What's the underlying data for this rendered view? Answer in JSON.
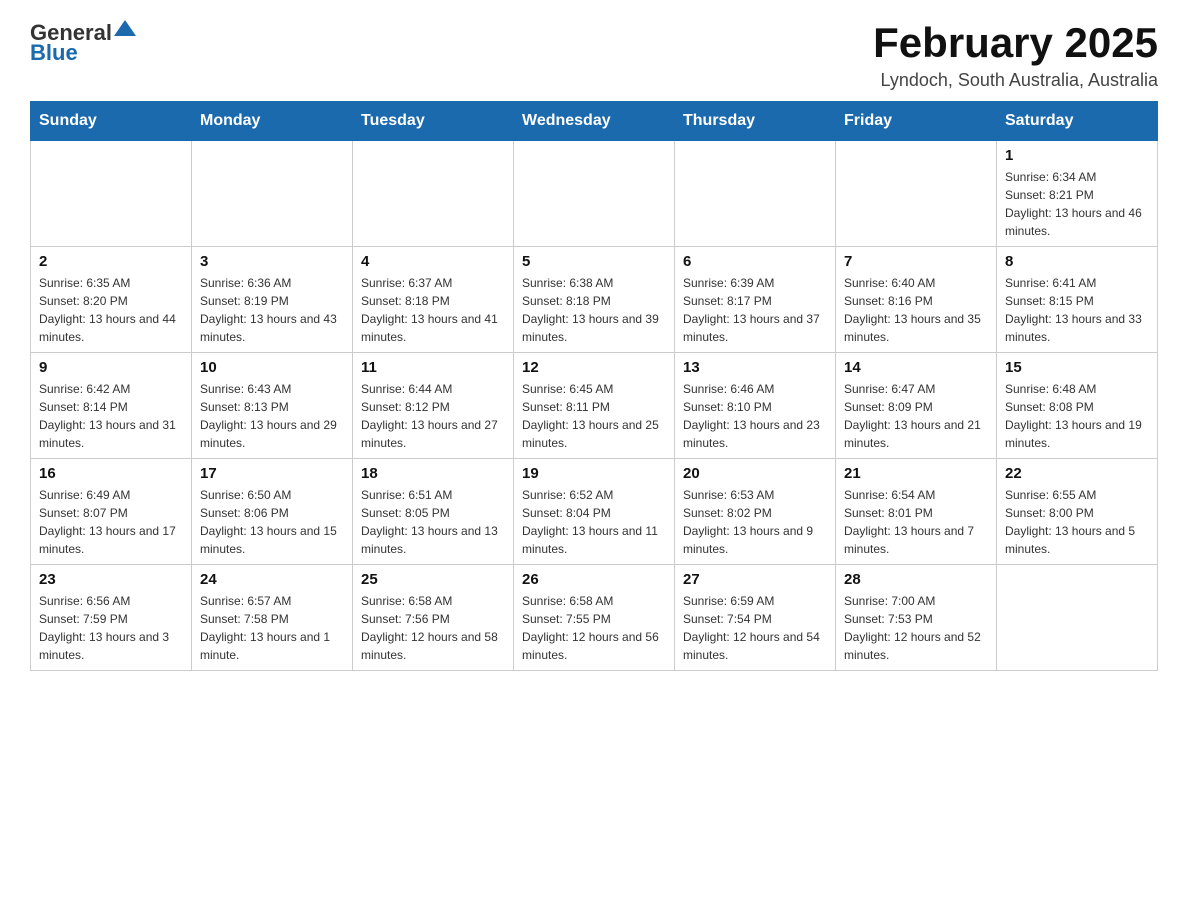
{
  "header": {
    "logo_general": "General",
    "logo_blue": "Blue",
    "title": "February 2025",
    "location": "Lyndoch, South Australia, Australia"
  },
  "days_of_week": [
    "Sunday",
    "Monday",
    "Tuesday",
    "Wednesday",
    "Thursday",
    "Friday",
    "Saturday"
  ],
  "weeks": [
    {
      "days": [
        {
          "num": "",
          "info": ""
        },
        {
          "num": "",
          "info": ""
        },
        {
          "num": "",
          "info": ""
        },
        {
          "num": "",
          "info": ""
        },
        {
          "num": "",
          "info": ""
        },
        {
          "num": "",
          "info": ""
        },
        {
          "num": "1",
          "info": "Sunrise: 6:34 AM\nSunset: 8:21 PM\nDaylight: 13 hours and 46 minutes."
        }
      ]
    },
    {
      "days": [
        {
          "num": "2",
          "info": "Sunrise: 6:35 AM\nSunset: 8:20 PM\nDaylight: 13 hours and 44 minutes."
        },
        {
          "num": "3",
          "info": "Sunrise: 6:36 AM\nSunset: 8:19 PM\nDaylight: 13 hours and 43 minutes."
        },
        {
          "num": "4",
          "info": "Sunrise: 6:37 AM\nSunset: 8:18 PM\nDaylight: 13 hours and 41 minutes."
        },
        {
          "num": "5",
          "info": "Sunrise: 6:38 AM\nSunset: 8:18 PM\nDaylight: 13 hours and 39 minutes."
        },
        {
          "num": "6",
          "info": "Sunrise: 6:39 AM\nSunset: 8:17 PM\nDaylight: 13 hours and 37 minutes."
        },
        {
          "num": "7",
          "info": "Sunrise: 6:40 AM\nSunset: 8:16 PM\nDaylight: 13 hours and 35 minutes."
        },
        {
          "num": "8",
          "info": "Sunrise: 6:41 AM\nSunset: 8:15 PM\nDaylight: 13 hours and 33 minutes."
        }
      ]
    },
    {
      "days": [
        {
          "num": "9",
          "info": "Sunrise: 6:42 AM\nSunset: 8:14 PM\nDaylight: 13 hours and 31 minutes."
        },
        {
          "num": "10",
          "info": "Sunrise: 6:43 AM\nSunset: 8:13 PM\nDaylight: 13 hours and 29 minutes."
        },
        {
          "num": "11",
          "info": "Sunrise: 6:44 AM\nSunset: 8:12 PM\nDaylight: 13 hours and 27 minutes."
        },
        {
          "num": "12",
          "info": "Sunrise: 6:45 AM\nSunset: 8:11 PM\nDaylight: 13 hours and 25 minutes."
        },
        {
          "num": "13",
          "info": "Sunrise: 6:46 AM\nSunset: 8:10 PM\nDaylight: 13 hours and 23 minutes."
        },
        {
          "num": "14",
          "info": "Sunrise: 6:47 AM\nSunset: 8:09 PM\nDaylight: 13 hours and 21 minutes."
        },
        {
          "num": "15",
          "info": "Sunrise: 6:48 AM\nSunset: 8:08 PM\nDaylight: 13 hours and 19 minutes."
        }
      ]
    },
    {
      "days": [
        {
          "num": "16",
          "info": "Sunrise: 6:49 AM\nSunset: 8:07 PM\nDaylight: 13 hours and 17 minutes."
        },
        {
          "num": "17",
          "info": "Sunrise: 6:50 AM\nSunset: 8:06 PM\nDaylight: 13 hours and 15 minutes."
        },
        {
          "num": "18",
          "info": "Sunrise: 6:51 AM\nSunset: 8:05 PM\nDaylight: 13 hours and 13 minutes."
        },
        {
          "num": "19",
          "info": "Sunrise: 6:52 AM\nSunset: 8:04 PM\nDaylight: 13 hours and 11 minutes."
        },
        {
          "num": "20",
          "info": "Sunrise: 6:53 AM\nSunset: 8:02 PM\nDaylight: 13 hours and 9 minutes."
        },
        {
          "num": "21",
          "info": "Sunrise: 6:54 AM\nSunset: 8:01 PM\nDaylight: 13 hours and 7 minutes."
        },
        {
          "num": "22",
          "info": "Sunrise: 6:55 AM\nSunset: 8:00 PM\nDaylight: 13 hours and 5 minutes."
        }
      ]
    },
    {
      "days": [
        {
          "num": "23",
          "info": "Sunrise: 6:56 AM\nSunset: 7:59 PM\nDaylight: 13 hours and 3 minutes."
        },
        {
          "num": "24",
          "info": "Sunrise: 6:57 AM\nSunset: 7:58 PM\nDaylight: 13 hours and 1 minute."
        },
        {
          "num": "25",
          "info": "Sunrise: 6:58 AM\nSunset: 7:56 PM\nDaylight: 12 hours and 58 minutes."
        },
        {
          "num": "26",
          "info": "Sunrise: 6:58 AM\nSunset: 7:55 PM\nDaylight: 12 hours and 56 minutes."
        },
        {
          "num": "27",
          "info": "Sunrise: 6:59 AM\nSunset: 7:54 PM\nDaylight: 12 hours and 54 minutes."
        },
        {
          "num": "28",
          "info": "Sunrise: 7:00 AM\nSunset: 7:53 PM\nDaylight: 12 hours and 52 minutes."
        },
        {
          "num": "",
          "info": ""
        }
      ]
    }
  ]
}
